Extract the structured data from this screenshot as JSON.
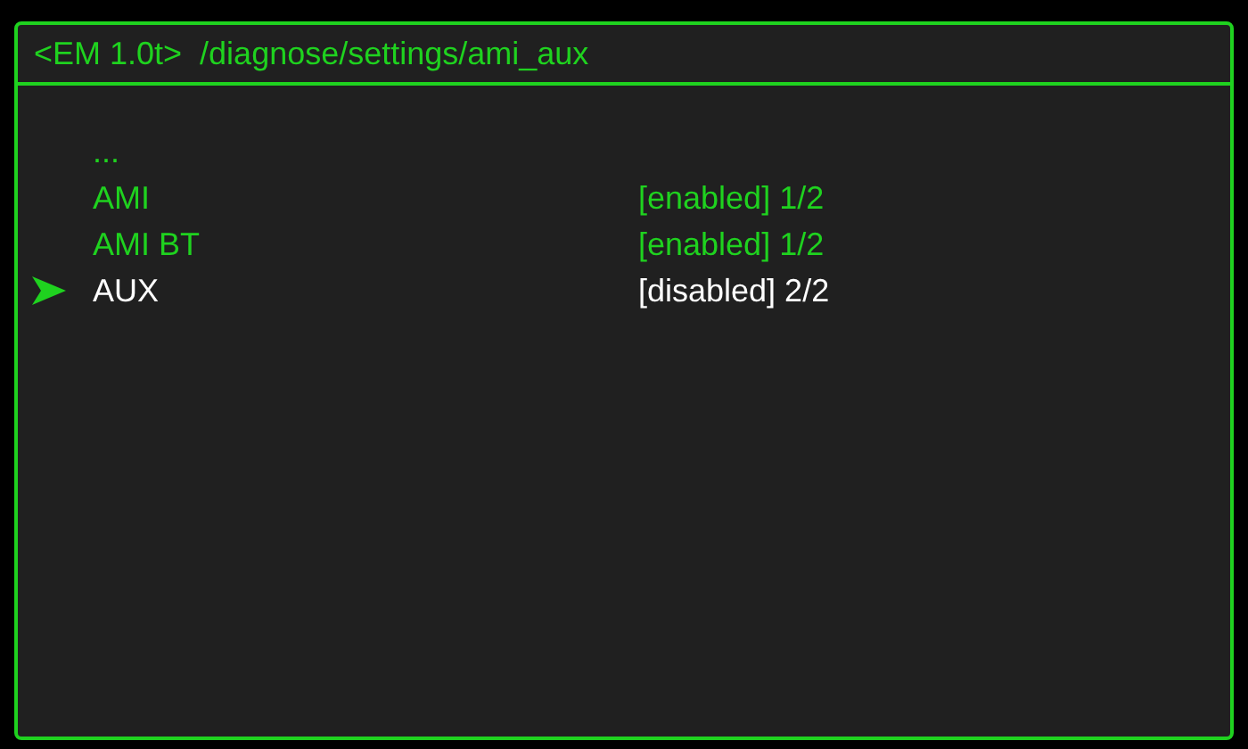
{
  "header": {
    "title": "<EM 1.0t>  /diagnose/settings/ami_aux"
  },
  "items": [
    {
      "label": "...",
      "value": "",
      "selected": false
    },
    {
      "label": "AMI",
      "value": "[enabled] 1/2",
      "selected": false
    },
    {
      "label": "AMI BT",
      "value": "[enabled] 1/2",
      "selected": false
    },
    {
      "label": "AUX",
      "value": "[disabled] 2/2",
      "selected": true
    }
  ]
}
